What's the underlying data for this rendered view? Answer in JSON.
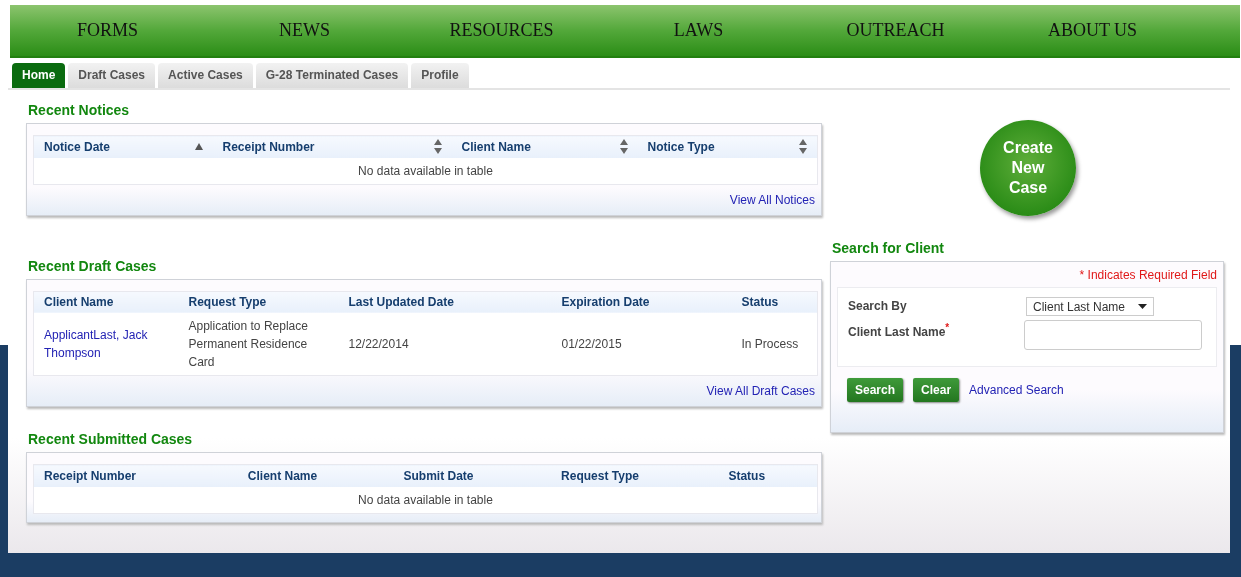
{
  "nav": [
    "FORMS",
    "NEWS",
    "RESOURCES",
    "LAWS",
    "OUTREACH",
    "ABOUT US"
  ],
  "tabs": [
    {
      "label": "Home",
      "selected": true
    },
    {
      "label": "Draft Cases",
      "selected": false
    },
    {
      "label": "Active Cases",
      "selected": false
    },
    {
      "label": "G-28 Terminated Cases",
      "selected": false
    },
    {
      "label": "Profile",
      "selected": false
    }
  ],
  "recent_notices": {
    "title": "Recent Notices",
    "columns": [
      {
        "label": "Notice Date",
        "sorted": true
      },
      {
        "label": "Receipt Number",
        "sorted": false
      },
      {
        "label": "Client Name",
        "sorted": false
      },
      {
        "label": "Notice Type",
        "sorted": false
      }
    ],
    "empty_message": "No data available in table",
    "link": "View All Notices"
  },
  "recent_draft_cases": {
    "title": "Recent Draft Cases",
    "columns": [
      {
        "label": "Client Name"
      },
      {
        "label": "Request Type"
      },
      {
        "label": "Last Updated Date"
      },
      {
        "label": "Expiration Date"
      },
      {
        "label": "Status"
      }
    ],
    "rows": [
      [
        "ApplicantLast, Jack Thompson",
        "Application to Replace Permanent Residence Card",
        "12/22/2014",
        "01/22/2015",
        "In Process"
      ]
    ],
    "link": "View All Draft Cases"
  },
  "recent_submitted_cases": {
    "title": "Recent Submitted Cases",
    "columns": [
      {
        "label": "Receipt Number"
      },
      {
        "label": "Client Name"
      },
      {
        "label": "Submit Date"
      },
      {
        "label": "Request Type"
      },
      {
        "label": "Status"
      }
    ],
    "empty_message": "No data available in table"
  },
  "create_case": {
    "label": "Create New Case"
  },
  "search_client": {
    "title": "Search for Client",
    "required_note": "* Indicates Required Field",
    "fields": [
      {
        "kind": "select",
        "label": "Search By",
        "value": "Client Last Name"
      },
      {
        "kind": "text",
        "label": "Client Last Name$^{*}$"
      }
    ],
    "buttons": [
      "Search",
      "Clear"
    ],
    "link": "Advanced Search"
  }
}
